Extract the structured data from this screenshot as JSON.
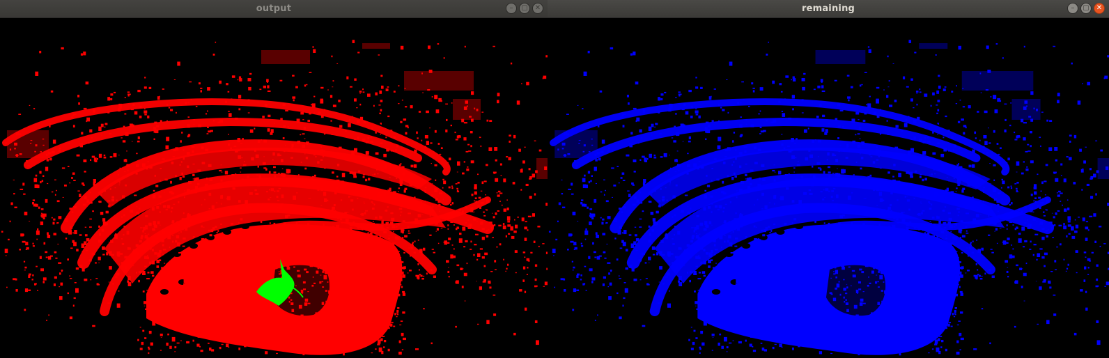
{
  "windows": {
    "output": {
      "title": "output",
      "cloud_color": "#ff0000",
      "highlight_color": "#00ff00",
      "controls": {
        "minimize_icon": "minimize-icon",
        "maximize_icon": "maximize-icon",
        "close_icon": "close-icon"
      }
    },
    "remaining": {
      "title": "remaining",
      "cloud_color": "#0000ff",
      "controls": {
        "minimize_icon": "minimize-icon",
        "maximize_icon": "maximize-icon",
        "close_icon": "close-icon"
      }
    }
  },
  "theme": {
    "titlebar_bg": "#3c3b37",
    "close_active": "#e95420",
    "background": "#000000"
  }
}
